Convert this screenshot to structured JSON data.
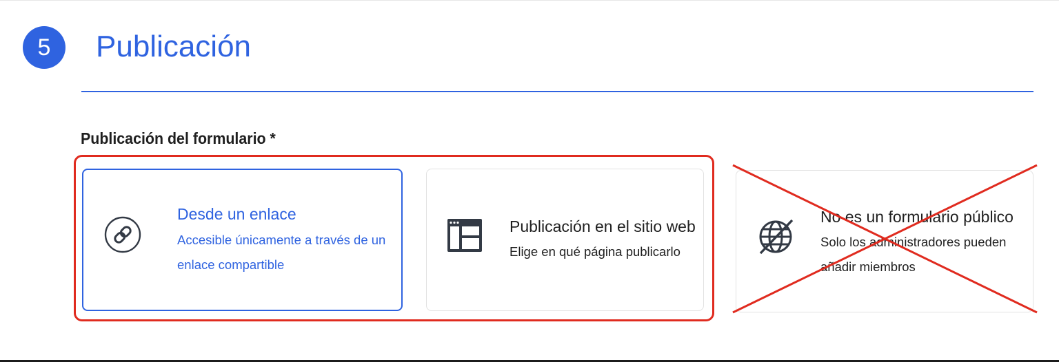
{
  "step": {
    "number": "5",
    "title": "Publicación"
  },
  "field": {
    "label": "Publicación del formulario *"
  },
  "options": [
    {
      "title": "Desde un enlace",
      "description": "Accesible únicamente a través de un enlace compartible",
      "icon": "link-icon",
      "selected": true
    },
    {
      "title": "Publicación en el sitio web",
      "description": "Elige en qué página publicarlo",
      "icon": "website-layout-icon",
      "selected": false
    },
    {
      "title": "No es un formulario público",
      "description": "Solo los administradores pueden añadir miembros",
      "icon": "globe-off-icon",
      "selected": false,
      "crossed_out": true
    }
  ],
  "colors": {
    "accent": "#2f63e0",
    "annotation_red": "#e02b1f",
    "text": "#1f1f1f"
  }
}
